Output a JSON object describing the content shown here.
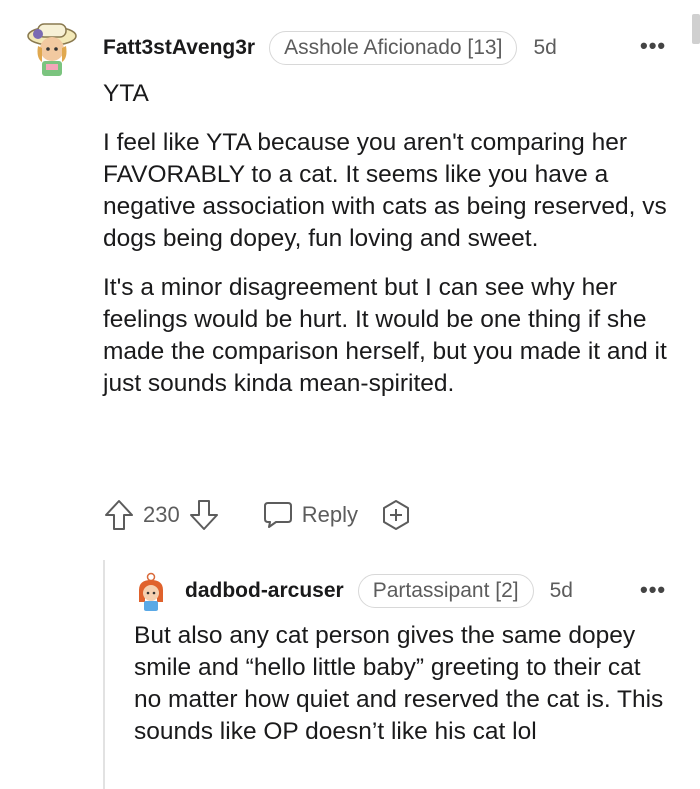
{
  "comment": {
    "username": "Fatt3stAveng3r",
    "flair": "Asshole Aficionado [13]",
    "time": "5d",
    "more_icon": "more-horizontal-icon",
    "body": [
      "YTA",
      "I feel like YTA because you aren't comparing her FAVORABLY to a cat. It seems like you have a negative association with cats as being reserved, vs dogs being dopey, fun loving and sweet.",
      "It's a minor disagreement but I can see why her feelings would be hurt. It would be one thing if she made the comparison herself, but you made it and it just sounds kinda mean-spirited."
    ],
    "score": "230",
    "reply_label": "Reply",
    "icons": {
      "upvote": "upvote-arrow-icon",
      "downvote": "downvote-arrow-icon",
      "reply": "speech-bubble-icon",
      "award": "award-plus-icon"
    }
  },
  "reply": {
    "username": "dadbod-arcuser",
    "flair": "Partassipant [2]",
    "time": "5d",
    "more_icon": "more-horizontal-icon",
    "body": [
      "But also any cat person gives the same dopey smile and “hello little baby” greeting to their cat no matter how quiet and reserved the cat is. This sounds like OP doesn’t like his cat lol"
    ]
  },
  "colors": {
    "text": "#1a1a1b",
    "meta": "#5c5c5c",
    "flair_border": "#d8d8d8",
    "thread_line": "#e2e2e2"
  }
}
